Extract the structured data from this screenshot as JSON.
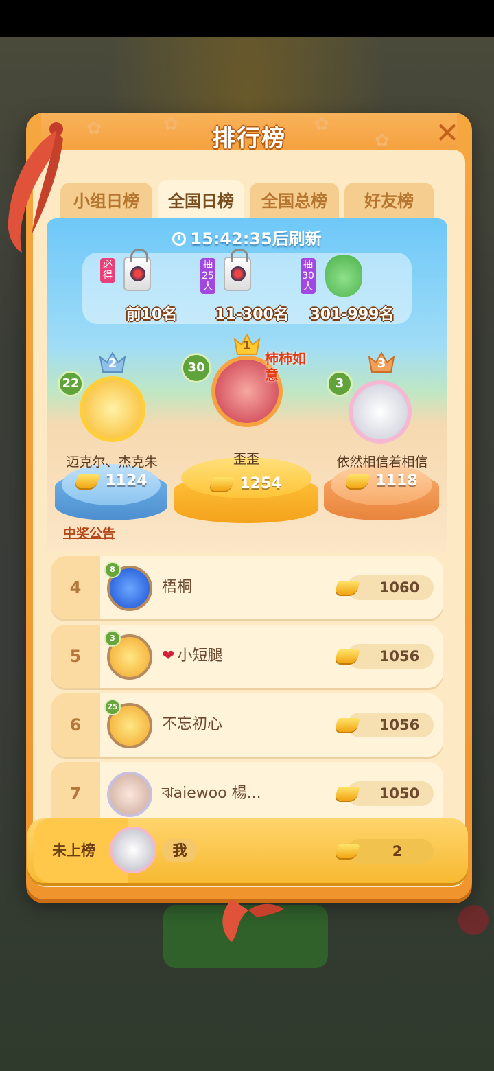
{
  "panel": {
    "title": "排行榜",
    "close_icon": "close-icon"
  },
  "tabs": [
    {
      "label": "小组日榜",
      "active": false
    },
    {
      "label": "全国日榜",
      "active": true
    },
    {
      "label": "全国总榜",
      "active": false
    },
    {
      "label": "好友榜",
      "active": false
    }
  ],
  "timer": {
    "text": "15:42:35后刷新",
    "icon": "clock-icon"
  },
  "prizes": [
    {
      "tag": "必得",
      "label": "前10名",
      "icon": "gift-bag-icon"
    },
    {
      "tag": "抽25人",
      "label": "11-300名",
      "icon": "gift-bag-icon"
    },
    {
      "tag": "抽30人",
      "label": "301-999名",
      "icon": "frog-plush-icon"
    }
  ],
  "podium": [
    {
      "rank": "2",
      "level": "22",
      "name": "迈克尔、杰克朱",
      "score": "1124"
    },
    {
      "rank": "1",
      "level": "30",
      "name": "歪歪",
      "score": "1254",
      "badge_text": "柿柿如意"
    },
    {
      "rank": "3",
      "level": "3",
      "name": "依然相信着相信",
      "score": "1118"
    }
  ],
  "notice": "中奖公告",
  "list": [
    {
      "rank": "4",
      "level": "8",
      "name": "梧桐",
      "score": "1060"
    },
    {
      "rank": "5",
      "level": "3",
      "name": "小短腿",
      "score": "1056",
      "name_icon": "lips-icon"
    },
    {
      "rank": "6",
      "level": "25",
      "name": "不忘初心",
      "score": "1056"
    },
    {
      "rank": "7",
      "level": "",
      "name": "ঝaiewoo 楊...",
      "score": "1050"
    }
  ],
  "me": {
    "label": "未上榜",
    "name": "我",
    "score": "2"
  },
  "colors": {
    "panel": "#f6a73f",
    "inner": "#fde9c3",
    "accent_text": "#b34718"
  }
}
